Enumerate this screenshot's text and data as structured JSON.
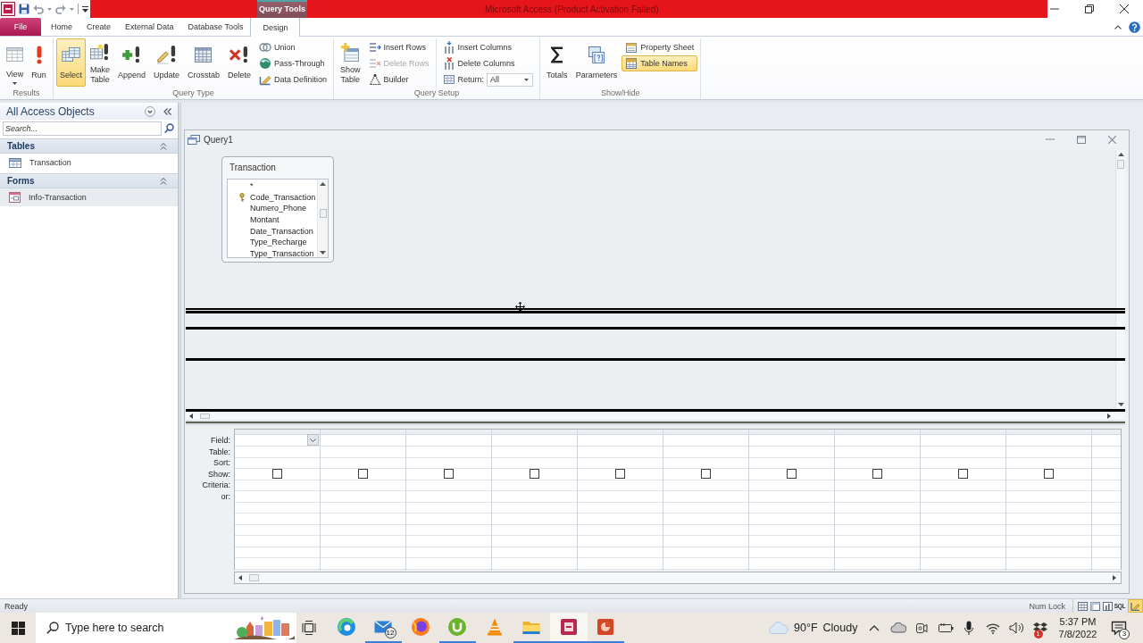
{
  "title_bar": {
    "title": "Microsoft Access (Product Activation Failed)",
    "context_label": "Query Tools"
  },
  "ribbon_tabs": [
    {
      "label": "File",
      "kind": "backstage",
      "selected": false
    },
    {
      "label": "Home",
      "kind": "tab",
      "selected": false
    },
    {
      "label": "Create",
      "kind": "tab",
      "selected": false
    },
    {
      "label": "External Data",
      "kind": "tab",
      "selected": false
    },
    {
      "label": "Database Tools",
      "kind": "tab",
      "selected": false
    },
    {
      "label": "Design",
      "kind": "contextual",
      "selected": true
    }
  ],
  "ribbon_groups": [
    {
      "label": "Results",
      "buttons": [
        {
          "label": "View",
          "kind": "large_menu",
          "selected": false,
          "disabled": false
        },
        {
          "label": "Run",
          "kind": "large",
          "selected": false,
          "disabled": false
        }
      ]
    },
    {
      "label": "Query Type",
      "buttons": [
        {
          "label": "Select",
          "kind": "large",
          "selected": true,
          "disabled": false
        },
        {
          "label": "Make Table",
          "kind": "large",
          "selected": false,
          "disabled": false
        },
        {
          "label": "Append",
          "kind": "large",
          "selected": false,
          "disabled": false
        },
        {
          "label": "Update",
          "kind": "large",
          "selected": false,
          "disabled": false
        },
        {
          "label": "Crosstab",
          "kind": "large",
          "selected": false,
          "disabled": false
        },
        {
          "label": "Delete",
          "kind": "large",
          "selected": false,
          "disabled": false
        },
        {
          "label": "Union",
          "kind": "small",
          "selected": false,
          "disabled": false
        },
        {
          "label": "Pass-Through",
          "kind": "small",
          "selected": false,
          "disabled": false
        },
        {
          "label": "Data Definition",
          "kind": "small",
          "selected": false,
          "disabled": false
        }
      ]
    },
    {
      "label": "Query Setup",
      "buttons": [
        {
          "label": "Show Table",
          "kind": "large",
          "selected": false,
          "disabled": false
        },
        {
          "label": "Insert Rows",
          "kind": "small",
          "selected": false,
          "disabled": false
        },
        {
          "label": "Delete Rows",
          "kind": "small",
          "selected": false,
          "disabled": true
        },
        {
          "label": "Builder",
          "kind": "small",
          "selected": false,
          "disabled": false
        },
        {
          "label": "Insert Columns",
          "kind": "small",
          "selected": false,
          "disabled": false
        },
        {
          "label": "Delete Columns",
          "kind": "small",
          "selected": false,
          "disabled": false
        },
        {
          "label": "Return:",
          "kind": "combo",
          "value": "All",
          "selected": false,
          "disabled": false
        }
      ]
    },
    {
      "label": "Show/Hide",
      "buttons": [
        {
          "label": "Totals",
          "kind": "large",
          "selected": false,
          "disabled": false
        },
        {
          "label": "Parameters",
          "kind": "large",
          "selected": false,
          "disabled": false
        },
        {
          "label": "Property Sheet",
          "kind": "small",
          "selected": false,
          "disabled": false
        },
        {
          "label": "Table Names",
          "kind": "small",
          "selected": true,
          "disabled": false
        }
      ]
    }
  ],
  "navigation_pane": {
    "title": "All Access Objects",
    "search": {
      "placeholder": "Search..."
    },
    "groups": [
      {
        "label": "Tables",
        "expanded": true,
        "items": [
          {
            "label": "Transaction",
            "highlighted": false
          }
        ]
      },
      {
        "label": "Forms",
        "expanded": true,
        "items": [
          {
            "label": "Info-Transaction",
            "highlighted": true
          }
        ]
      }
    ]
  },
  "query_window": {
    "title": "Query1",
    "field_lists": [
      {
        "title": "Transaction",
        "fields": [
          {
            "label": "*",
            "primary_key": false
          },
          {
            "label": "Code_Transaction",
            "primary_key": true
          },
          {
            "label": "Numero_Phone",
            "primary_key": false
          },
          {
            "label": "Montant",
            "primary_key": false
          },
          {
            "label": "Date_Transaction",
            "primary_key": false
          },
          {
            "label": "Type_Recharge",
            "primary_key": false
          },
          {
            "label": "Type_Transaction",
            "primary_key": false
          }
        ]
      }
    ],
    "grid": {
      "row_labels": [
        "Field:",
        "Table:",
        "Sort:",
        "Show:",
        "Criteria:",
        "or:"
      ],
      "columns": [
        {
          "focused": true,
          "show": false
        },
        {
          "focused": false,
          "show": false
        },
        {
          "focused": false,
          "show": false
        },
        {
          "focused": false,
          "show": false
        },
        {
          "focused": false,
          "show": false
        },
        {
          "focused": false,
          "show": false
        },
        {
          "focused": false,
          "show": false
        },
        {
          "focused": false,
          "show": false
        },
        {
          "focused": false,
          "show": false
        },
        {
          "focused": false,
          "show": false
        }
      ]
    }
  },
  "status_bar": {
    "message": "Ready",
    "indicator": "Num Lock",
    "views": [
      {
        "selected": false
      },
      {
        "selected": false
      },
      {
        "selected": false
      },
      {
        "label": "SQL",
        "selected": false
      },
      {
        "selected": true
      }
    ]
  },
  "taskbar": {
    "search": {
      "placeholder": "Type here to search"
    },
    "apps": [
      {
        "running": false,
        "active": false
      },
      {
        "running": true,
        "active": false,
        "badge": "12"
      },
      {
        "running": false,
        "active": false
      },
      {
        "running": true,
        "active": false
      },
      {
        "running": false,
        "active": false
      },
      {
        "running": true,
        "active": false
      },
      {
        "running": true,
        "active": true
      },
      {
        "running": true,
        "active": false
      }
    ],
    "weather": {
      "temperature": "90°F",
      "condition": "Cloudy"
    },
    "tray_badge": "1",
    "clock": {
      "time": "5:37 PM",
      "date": "7/8/2022"
    },
    "notification_badge": "3"
  }
}
